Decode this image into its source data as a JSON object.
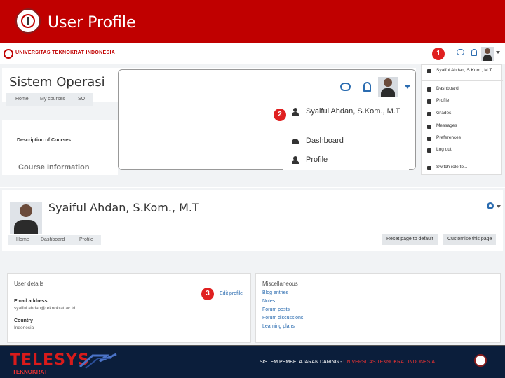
{
  "header": {
    "title": "User Profile"
  },
  "top_screenshot": {
    "university": "UNIVERSITAS TEKNOKRAT INDONESIA",
    "course_title": "Sistem Operasi",
    "breadcrumbs": [
      "Home",
      "My courses",
      "SO"
    ],
    "description_label": "Description of Courses:",
    "course_info": "Course Information",
    "zoom_menu": {
      "user_name": "Syaiful Ahdan, S.Kom., M.T",
      "items": [
        "Dashboard",
        "Profile"
      ]
    },
    "side_menu": {
      "user_name": "Syaiful Ahdan, S.Kom., M.T",
      "items": [
        "Dashboard",
        "Profile",
        "Grades",
        "Messages",
        "Preferences",
        "Log out"
      ],
      "switch_role": "Switch role to..."
    },
    "badges": {
      "b1": "1",
      "b2": "2"
    }
  },
  "profile": {
    "name": "Syaiful Ahdan, S.Kom., M.T",
    "breadcrumbs": [
      "Home",
      "Dashboard",
      "Profile"
    ],
    "reset_button": "Reset page to default",
    "customise_button": "Customise this page",
    "user_details": {
      "title": "User details",
      "edit_profile": "Edit profile",
      "email_label": "Email address",
      "email_value": "syaiful.ahdan@teknokrat.ac.id",
      "country_label": "Country",
      "country_value": "Indonesia"
    },
    "misc": {
      "title": "Miscellaneous",
      "links": [
        "Blog entries",
        "Notes",
        "Forum posts",
        "Forum discussions",
        "Learning plans"
      ]
    },
    "badge3": "3"
  },
  "footer": {
    "brand": "TELESYS",
    "sub": "TEKNOKRAT",
    "text_a": "SISTEM PEMBELAJARAN DARING -",
    "text_b": "UNIVERSITAS TEKNOKRAT INDONESIA"
  }
}
